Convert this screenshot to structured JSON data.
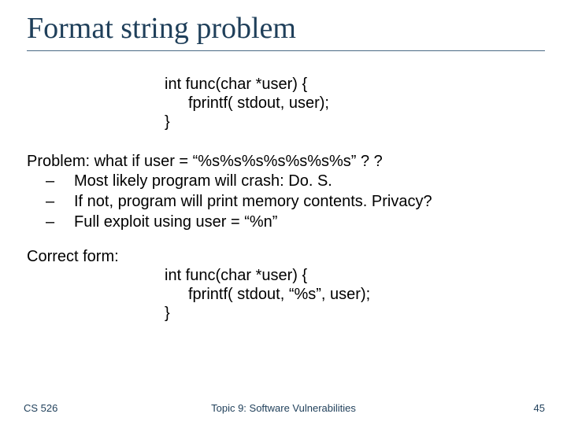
{
  "title": "Format string problem",
  "code1": {
    "l1": "int  func(char *user) {",
    "l2": "fprintf( stdout, user);",
    "l3": "}"
  },
  "problem": {
    "intro": "Problem:   what if   user = “%s%s%s%s%s%s%s”  ? ?",
    "items": [
      "Most likely program will crash:   Do. S.",
      "If not, program will print memory contents.  Privacy?",
      "Full exploit using   user = “%n”"
    ]
  },
  "correct_label": "Correct form:",
  "code2": {
    "l1": "int  func(char *user) {",
    "l2": "fprintf( stdout, “%s”, user);",
    "l3": "}"
  },
  "footer": {
    "left": "CS 526",
    "center": "Topic 9: Software Vulnerabilities",
    "right": "45"
  }
}
